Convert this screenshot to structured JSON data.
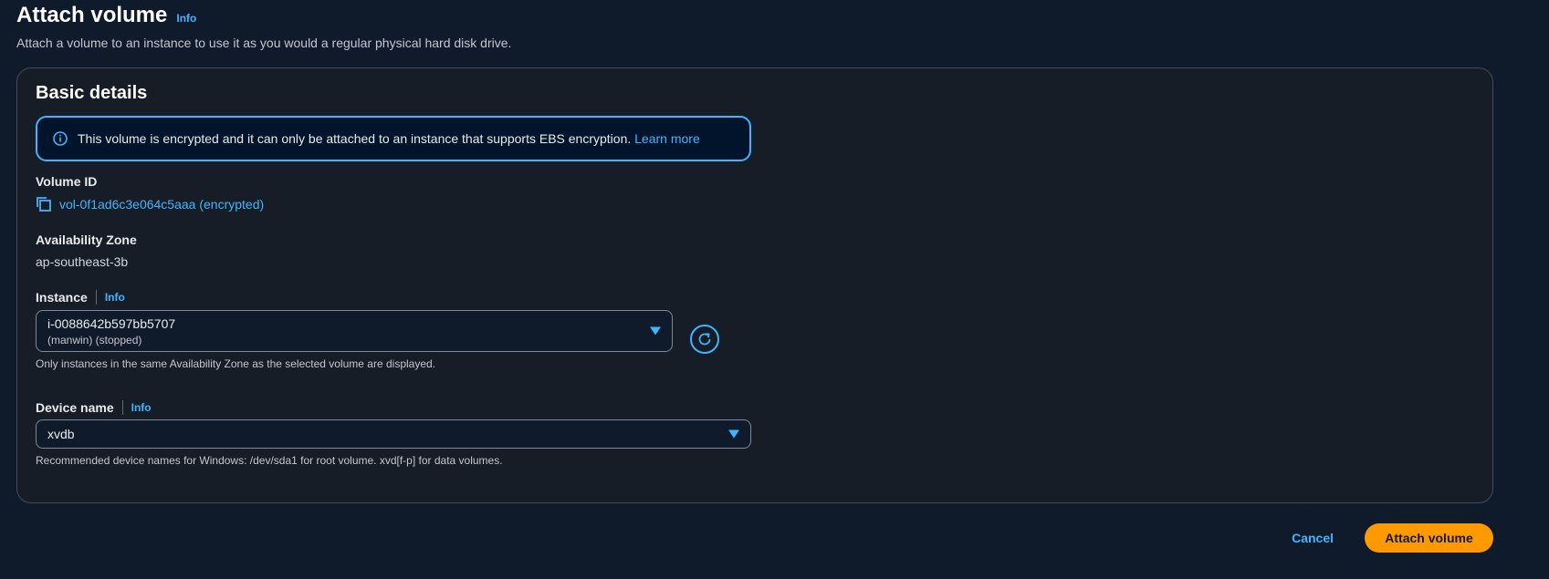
{
  "header": {
    "title": "Attach volume",
    "info": "Info",
    "subtitle": "Attach a volume to an instance to use it as you would a regular physical hard disk drive."
  },
  "basic_details": {
    "title": "Basic details",
    "alert": {
      "text": "This volume is encrypted and it can only be attached to an instance that supports EBS encryption.",
      "link": "Learn more",
      "icon": "info-circle-icon"
    },
    "volume_id": {
      "label": "Volume ID",
      "value": "vol-0f1ad6c3e064c5aaa (encrypted)",
      "icon": "copy-icon"
    },
    "availability_zone": {
      "label": "Availability Zone",
      "value": "ap-southeast-3b"
    },
    "instance": {
      "label": "Instance",
      "info": "Info",
      "selected": "i-0088642b597bb5707",
      "selected_detail": "(manwin) (stopped)",
      "hint": "Only instances in the same Availability Zone as the selected volume are displayed.",
      "refresh_icon": "refresh-icon"
    },
    "device_name": {
      "label": "Device name",
      "info": "Info",
      "selected": "xvdb",
      "hint": "Recommended device names for Windows: /dev/sda1 for root volume. xvd[f-p] for data volumes."
    }
  },
  "actions": {
    "cancel": "Cancel",
    "submit": "Attach volume"
  },
  "colors": {
    "background": "#0f1b2a",
    "panel": "#161d26",
    "link": "#42b4ff",
    "primary": "#ff9900"
  }
}
